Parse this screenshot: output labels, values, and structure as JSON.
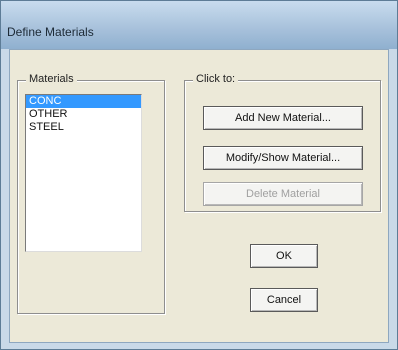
{
  "window": {
    "title": "Define Materials"
  },
  "materials_group": {
    "label": "Materials",
    "items": [
      {
        "label": "CONC",
        "selected": true
      },
      {
        "label": "OTHER",
        "selected": false
      },
      {
        "label": "STEEL",
        "selected": false
      }
    ]
  },
  "actions_group": {
    "label": "Click to:",
    "add_label": "Add New Material...",
    "modify_label": "Modify/Show Material...",
    "delete_label": "Delete Material"
  },
  "buttons": {
    "ok_label": "OK",
    "cancel_label": "Cancel"
  },
  "colors": {
    "selection": "#3399ff",
    "dialog_face": "#ece9d8",
    "title_bar": "#a9c2dc"
  }
}
